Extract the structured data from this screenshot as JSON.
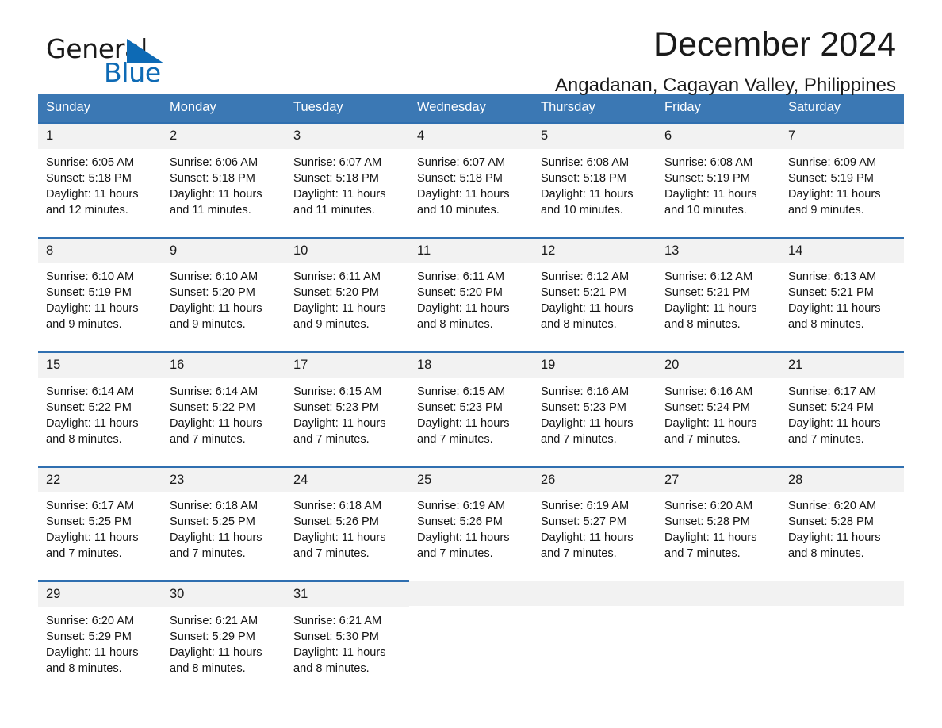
{
  "brand": {
    "name_part1": "General",
    "name_part2": "Blue",
    "triangle_color": "#0d6ab5",
    "accent_color": "#3b78b4"
  },
  "header": {
    "title": "December 2024",
    "subtitle": "Angadanan, Cagayan Valley, Philippines"
  },
  "weekdays": [
    "Sunday",
    "Monday",
    "Tuesday",
    "Wednesday",
    "Thursday",
    "Friday",
    "Saturday"
  ],
  "labels": {
    "sunrise_prefix": "Sunrise: ",
    "sunset_prefix": "Sunset: ",
    "daylight_prefix": "Daylight: "
  },
  "weeks": [
    [
      {
        "date": "1",
        "sunrise": "Sunrise: 6:05 AM",
        "sunset": "Sunset: 5:18 PM",
        "daylight1": "Daylight: 11 hours",
        "daylight2": "and 12 minutes."
      },
      {
        "date": "2",
        "sunrise": "Sunrise: 6:06 AM",
        "sunset": "Sunset: 5:18 PM",
        "daylight1": "Daylight: 11 hours",
        "daylight2": "and 11 minutes."
      },
      {
        "date": "3",
        "sunrise": "Sunrise: 6:07 AM",
        "sunset": "Sunset: 5:18 PM",
        "daylight1": "Daylight: 11 hours",
        "daylight2": "and 11 minutes."
      },
      {
        "date": "4",
        "sunrise": "Sunrise: 6:07 AM",
        "sunset": "Sunset: 5:18 PM",
        "daylight1": "Daylight: 11 hours",
        "daylight2": "and 10 minutes."
      },
      {
        "date": "5",
        "sunrise": "Sunrise: 6:08 AM",
        "sunset": "Sunset: 5:18 PM",
        "daylight1": "Daylight: 11 hours",
        "daylight2": "and 10 minutes."
      },
      {
        "date": "6",
        "sunrise": "Sunrise: 6:08 AM",
        "sunset": "Sunset: 5:19 PM",
        "daylight1": "Daylight: 11 hours",
        "daylight2": "and 10 minutes."
      },
      {
        "date": "7",
        "sunrise": "Sunrise: 6:09 AM",
        "sunset": "Sunset: 5:19 PM",
        "daylight1": "Daylight: 11 hours",
        "daylight2": "and 9 minutes."
      }
    ],
    [
      {
        "date": "8",
        "sunrise": "Sunrise: 6:10 AM",
        "sunset": "Sunset: 5:19 PM",
        "daylight1": "Daylight: 11 hours",
        "daylight2": "and 9 minutes."
      },
      {
        "date": "9",
        "sunrise": "Sunrise: 6:10 AM",
        "sunset": "Sunset: 5:20 PM",
        "daylight1": "Daylight: 11 hours",
        "daylight2": "and 9 minutes."
      },
      {
        "date": "10",
        "sunrise": "Sunrise: 6:11 AM",
        "sunset": "Sunset: 5:20 PM",
        "daylight1": "Daylight: 11 hours",
        "daylight2": "and 9 minutes."
      },
      {
        "date": "11",
        "sunrise": "Sunrise: 6:11 AM",
        "sunset": "Sunset: 5:20 PM",
        "daylight1": "Daylight: 11 hours",
        "daylight2": "and 8 minutes."
      },
      {
        "date": "12",
        "sunrise": "Sunrise: 6:12 AM",
        "sunset": "Sunset: 5:21 PM",
        "daylight1": "Daylight: 11 hours",
        "daylight2": "and 8 minutes."
      },
      {
        "date": "13",
        "sunrise": "Sunrise: 6:12 AM",
        "sunset": "Sunset: 5:21 PM",
        "daylight1": "Daylight: 11 hours",
        "daylight2": "and 8 minutes."
      },
      {
        "date": "14",
        "sunrise": "Sunrise: 6:13 AM",
        "sunset": "Sunset: 5:21 PM",
        "daylight1": "Daylight: 11 hours",
        "daylight2": "and 8 minutes."
      }
    ],
    [
      {
        "date": "15",
        "sunrise": "Sunrise: 6:14 AM",
        "sunset": "Sunset: 5:22 PM",
        "daylight1": "Daylight: 11 hours",
        "daylight2": "and 8 minutes."
      },
      {
        "date": "16",
        "sunrise": "Sunrise: 6:14 AM",
        "sunset": "Sunset: 5:22 PM",
        "daylight1": "Daylight: 11 hours",
        "daylight2": "and 7 minutes."
      },
      {
        "date": "17",
        "sunrise": "Sunrise: 6:15 AM",
        "sunset": "Sunset: 5:23 PM",
        "daylight1": "Daylight: 11 hours",
        "daylight2": "and 7 minutes."
      },
      {
        "date": "18",
        "sunrise": "Sunrise: 6:15 AM",
        "sunset": "Sunset: 5:23 PM",
        "daylight1": "Daylight: 11 hours",
        "daylight2": "and 7 minutes."
      },
      {
        "date": "19",
        "sunrise": "Sunrise: 6:16 AM",
        "sunset": "Sunset: 5:23 PM",
        "daylight1": "Daylight: 11 hours",
        "daylight2": "and 7 minutes."
      },
      {
        "date": "20",
        "sunrise": "Sunrise: 6:16 AM",
        "sunset": "Sunset: 5:24 PM",
        "daylight1": "Daylight: 11 hours",
        "daylight2": "and 7 minutes."
      },
      {
        "date": "21",
        "sunrise": "Sunrise: 6:17 AM",
        "sunset": "Sunset: 5:24 PM",
        "daylight1": "Daylight: 11 hours",
        "daylight2": "and 7 minutes."
      }
    ],
    [
      {
        "date": "22",
        "sunrise": "Sunrise: 6:17 AM",
        "sunset": "Sunset: 5:25 PM",
        "daylight1": "Daylight: 11 hours",
        "daylight2": "and 7 minutes."
      },
      {
        "date": "23",
        "sunrise": "Sunrise: 6:18 AM",
        "sunset": "Sunset: 5:25 PM",
        "daylight1": "Daylight: 11 hours",
        "daylight2": "and 7 minutes."
      },
      {
        "date": "24",
        "sunrise": "Sunrise: 6:18 AM",
        "sunset": "Sunset: 5:26 PM",
        "daylight1": "Daylight: 11 hours",
        "daylight2": "and 7 minutes."
      },
      {
        "date": "25",
        "sunrise": "Sunrise: 6:19 AM",
        "sunset": "Sunset: 5:26 PM",
        "daylight1": "Daylight: 11 hours",
        "daylight2": "and 7 minutes."
      },
      {
        "date": "26",
        "sunrise": "Sunrise: 6:19 AM",
        "sunset": "Sunset: 5:27 PM",
        "daylight1": "Daylight: 11 hours",
        "daylight2": "and 7 minutes."
      },
      {
        "date": "27",
        "sunrise": "Sunrise: 6:20 AM",
        "sunset": "Sunset: 5:28 PM",
        "daylight1": "Daylight: 11 hours",
        "daylight2": "and 7 minutes."
      },
      {
        "date": "28",
        "sunrise": "Sunrise: 6:20 AM",
        "sunset": "Sunset: 5:28 PM",
        "daylight1": "Daylight: 11 hours",
        "daylight2": "and 8 minutes."
      }
    ],
    [
      {
        "date": "29",
        "sunrise": "Sunrise: 6:20 AM",
        "sunset": "Sunset: 5:29 PM",
        "daylight1": "Daylight: 11 hours",
        "daylight2": "and 8 minutes."
      },
      {
        "date": "30",
        "sunrise": "Sunrise: 6:21 AM",
        "sunset": "Sunset: 5:29 PM",
        "daylight1": "Daylight: 11 hours",
        "daylight2": "and 8 minutes."
      },
      {
        "date": "31",
        "sunrise": "Sunrise: 6:21 AM",
        "sunset": "Sunset: 5:30 PM",
        "daylight1": "Daylight: 11 hours",
        "daylight2": "and 8 minutes."
      },
      {
        "date": "",
        "sunrise": "",
        "sunset": "",
        "daylight1": "",
        "daylight2": ""
      },
      {
        "date": "",
        "sunrise": "",
        "sunset": "",
        "daylight1": "",
        "daylight2": ""
      },
      {
        "date": "",
        "sunrise": "",
        "sunset": "",
        "daylight1": "",
        "daylight2": ""
      },
      {
        "date": "",
        "sunrise": "",
        "sunset": "",
        "daylight1": "",
        "daylight2": ""
      }
    ]
  ]
}
